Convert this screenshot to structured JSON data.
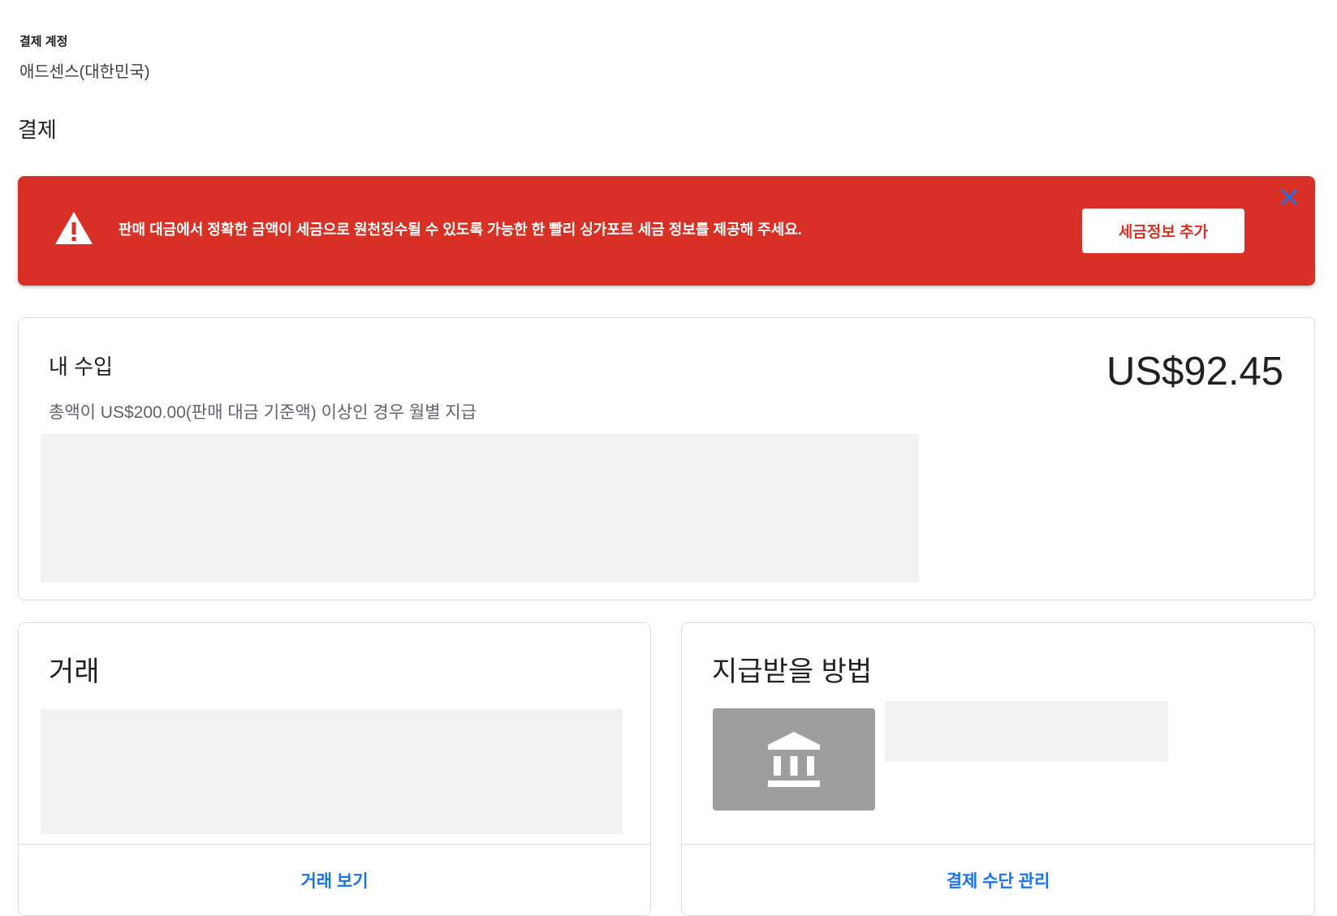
{
  "header": {
    "account_label": "결제 계정",
    "account_value": "애드센스(대한민국)",
    "page_title": "결제"
  },
  "alert": {
    "message": "판매 대금에서 정확한 금액이 세금으로 원천징수될 수 있도록 가능한 한 빨리 싱가포르 세금 정보를 제공해 주세요.",
    "button_label": "세금정보 추가",
    "icon": "warning-icon",
    "close_icon": "close-icon",
    "colors": {
      "background": "#d93025",
      "close": "#1a73e8"
    }
  },
  "earnings": {
    "title": "내 수입",
    "amount": "US$92.45",
    "subtitle": "총액이 US$200.00(판매 대금 기준액) 이상인 경우 월별 지급"
  },
  "transactions": {
    "title": "거래",
    "link_label": "거래 보기"
  },
  "payment_method": {
    "title": "지급받을 방법",
    "icon": "bank-icon",
    "link_label": "결제 수단 관리"
  },
  "colors": {
    "link": "#1a73e8",
    "placeholder": "#f1f1f1"
  }
}
